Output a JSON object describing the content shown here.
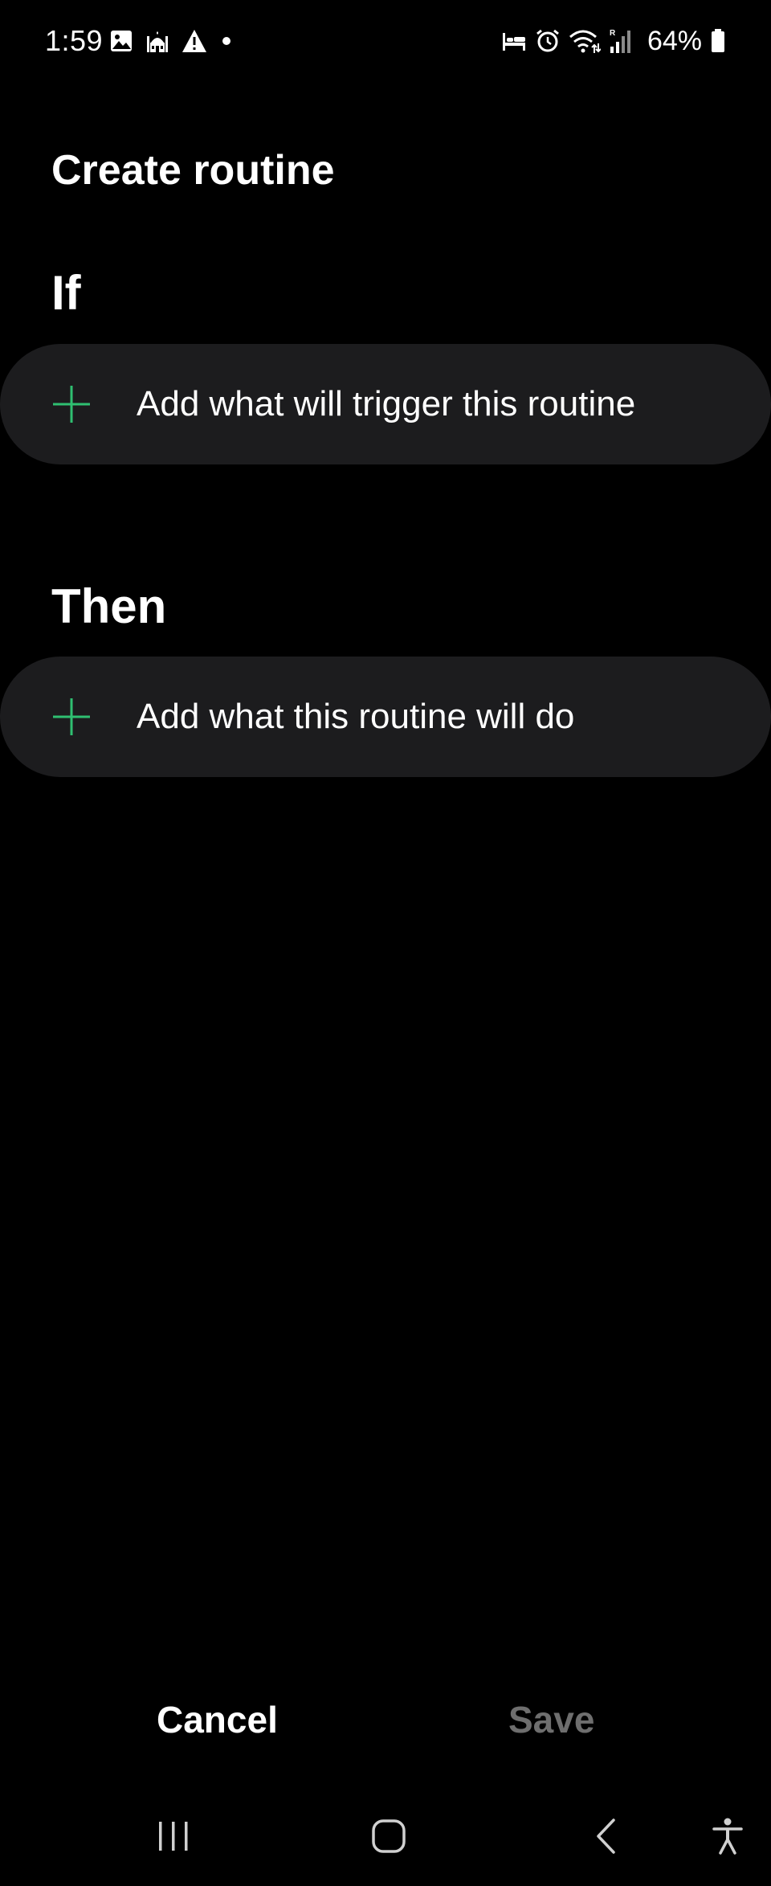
{
  "status_bar": {
    "time": "1:59",
    "battery": "64%",
    "left_icons": [
      "gallery-icon",
      "mosque-icon",
      "warning-icon",
      "dot-icon"
    ],
    "right_icons": [
      "bed-icon",
      "alarm-icon",
      "wifi-icon",
      "signal-icon",
      "battery-icon"
    ]
  },
  "page": {
    "title": "Create routine"
  },
  "if_section": {
    "heading": "If",
    "add_label": "Add what will trigger this routine"
  },
  "then_section": {
    "heading": "Then",
    "add_label": "Add what this routine will do"
  },
  "actions": {
    "cancel_label": "Cancel",
    "save_label": "Save"
  },
  "navigation": {
    "icons": [
      "recents-icon",
      "home-icon",
      "back-icon",
      "accessibility-icon"
    ]
  },
  "colors": {
    "background": "#000000",
    "card": "#1c1c1e",
    "accent_plus": "#2fbf71",
    "disabled_text": "#6e6e6e"
  }
}
